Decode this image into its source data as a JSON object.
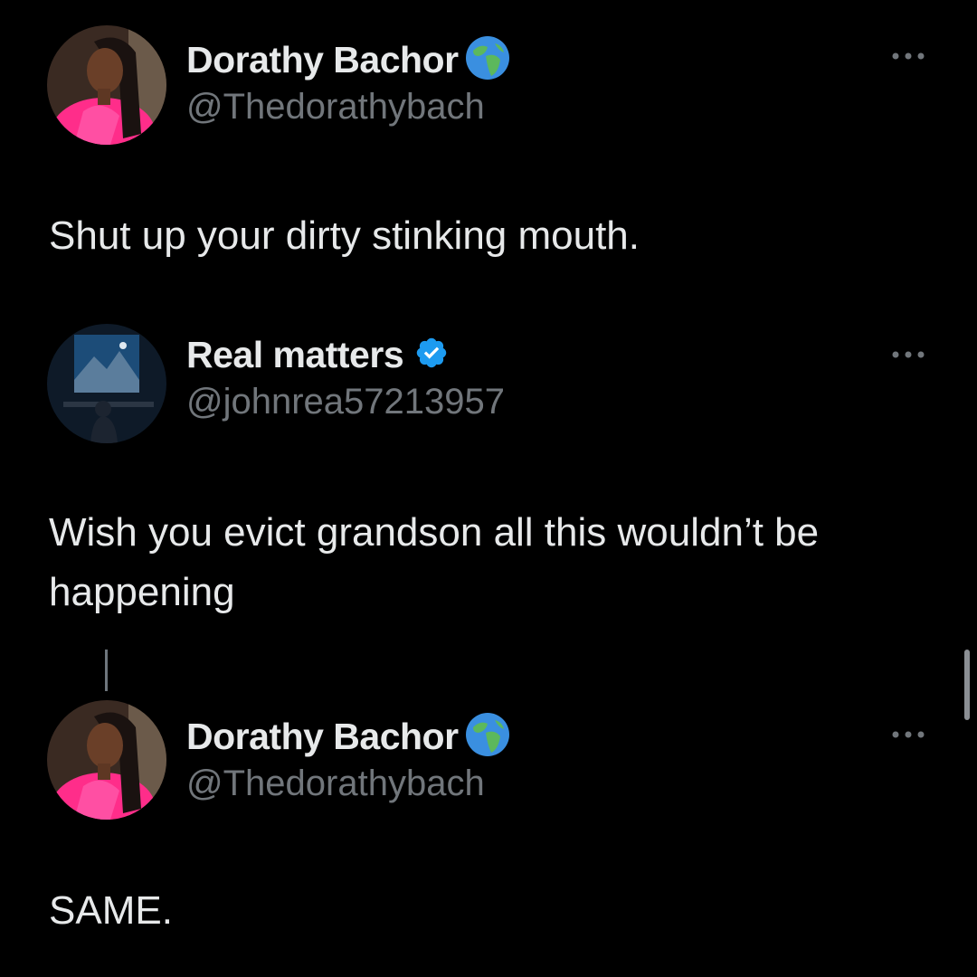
{
  "tweets": [
    {
      "display_name": "Dorathy Bachor",
      "handle": "@Thedorathybach",
      "badge": "globe-emoji",
      "text": "Shut up your dirty stinking mouth."
    },
    {
      "display_name": "Real matters",
      "handle": "@johnrea57213957",
      "badge": "verified-checkmark",
      "text": "Wish you evict grandson all this wouldn’t be happening"
    },
    {
      "display_name": "Dorathy Bachor",
      "handle": "@Thedorathybach",
      "badge": "globe-emoji",
      "text": "SAME."
    }
  ],
  "colors": {
    "background": "#000000",
    "primary_text": "#e7e9ea",
    "secondary_text": "#71767b",
    "verified_blue": "#1d9bf0",
    "avatar_pink": "#ff2d8a"
  }
}
